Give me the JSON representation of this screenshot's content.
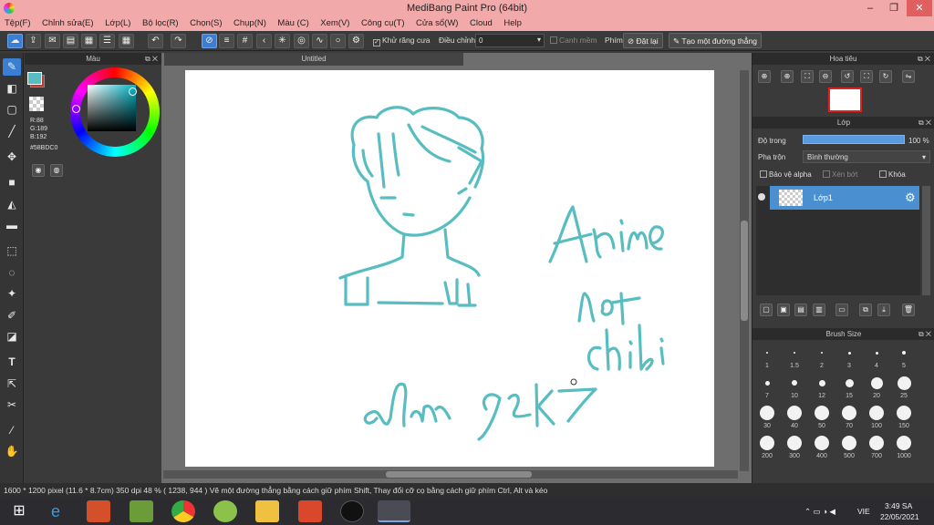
{
  "window": {
    "title": "MediBang Paint Pro (64bit)",
    "min": "–",
    "max": "❐",
    "close": "✕"
  },
  "menu": [
    "Tệp(F)",
    "Chỉnh sửa(E)",
    "Lớp(L)",
    "Bộ lọc(R)",
    "Chọn(S)",
    "Chụp(N)",
    "Màu (C)",
    "Xem(V)",
    "Công cụ(T)",
    "Cửa sổ(W)",
    "Cloud",
    "Help"
  ],
  "toolbar": {
    "antialias_label": "Khử răng cưa",
    "adjust_label": "Điều chỉnh",
    "adjust_value": "0",
    "edge_label": "Canh mềm",
    "key_label": "Phím",
    "reset_label": "Đặt lại",
    "line_label": "Tạo một đường thẳng"
  },
  "color_panel": {
    "title": "Màu",
    "r": "R:88",
    "g": "G:189",
    "b": "B:192",
    "hex": "#58BDC0",
    "fg_color": "#58BDC0",
    "bg_color": "#c0392b"
  },
  "document": {
    "tab": "Untitled"
  },
  "drawing": {
    "stroke_color": "#58BDC0",
    "text1": "Anime",
    "text2": "not",
    "text3": "chibi",
    "signature": "Ahm",
    "signature2": "2K7"
  },
  "navigator": {
    "title": "Hoa tiêu"
  },
  "layer_panel": {
    "title": "Lớp",
    "opacity_label": "Độ trong",
    "opacity_value": "100 %",
    "opacity": 1.0,
    "blend_label": "Pha trộn",
    "blend_value": "Bình thường",
    "protect_alpha": "Bảo vệ alpha",
    "clipping": "Xén bớt",
    "lock": "Khóa",
    "layer_name": "Lớp1"
  },
  "brush_size": {
    "title": "Brush Size",
    "sizes": [
      "1",
      "1.5",
      "2",
      "3",
      "4",
      "5",
      "7",
      "10",
      "12",
      "15",
      "20",
      "25",
      "30",
      "40",
      "50",
      "70",
      "100",
      "150",
      "200",
      "300",
      "400",
      "500",
      "700",
      "1000"
    ]
  },
  "status": "1600 * 1200 pixel   (11.6 * 8.7cm)   350 dpi   48 %   ( 1238, 944 )   Vẽ một đường thẳng bằng cách giữ phím Shift, Thay đổi cỡ cọ bằng cách giữ phím Ctrl, Alt và kéo",
  "taskbar": {
    "lang": "VIE",
    "time": "3:49 SA",
    "date": "22/05/2021"
  }
}
